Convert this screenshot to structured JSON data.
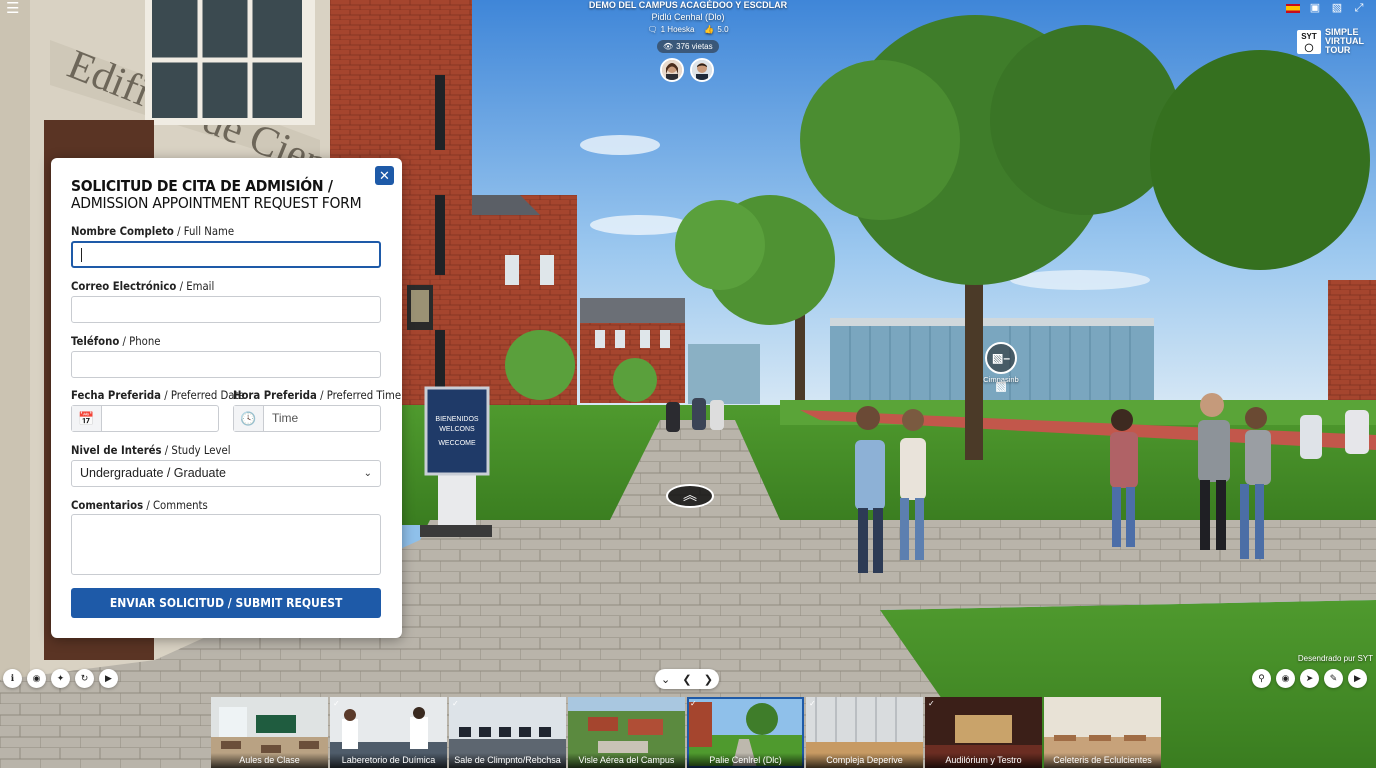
{
  "header": {
    "menu_icon": "hamburger-icon",
    "title": "DEMO DEL CAMPUS ACAGÉDOO Y ESCDLAR",
    "subtitle": "Pidlú Cenhal (Dlo)",
    "hosts": "1 Hoeska",
    "rating": "5.0",
    "views": "376 vietas"
  },
  "top_right_icons": [
    "flag-spain-icon",
    "info-box-icon",
    "vr-icon",
    "fullscreen-icon"
  ],
  "logo": {
    "box": "SYT",
    "line1": "SIMPLE",
    "line2": "VIRTUAL",
    "line3": "TOUR"
  },
  "scene": {
    "sign_line1": "BIENENIDOS",
    "sign_line2": "WELCONS",
    "sign_line3": "WECCOME",
    "building_text": "Edificio de Cien",
    "gym_label": "Cimnasinb"
  },
  "form": {
    "title_es": "SOLICITUD DE CITA DE ADMISIÓN /",
    "title_en": "ADMISSION APPOINTMENT REQUEST FORM",
    "name_label_es": "Nombre Completo",
    "name_label_en": " / Full Name",
    "name_value": "",
    "email_label_es": "Correo Electrónico",
    "email_label_en": " / Email",
    "email_value": "",
    "phone_label_es": "Teléfono",
    "phone_label_en": " / Phone",
    "phone_value": "",
    "date_label_es": "Fecha Preferida",
    "date_label_en": " / Preferred Date",
    "date_value": "",
    "time_label_es": "Hora Preferida",
    "time_label_en": " / Preferred Time",
    "time_placeholder": "Time",
    "level_label_es": "Nivel de Interés",
    "level_label_en": " / Study Level",
    "level_value": "Undergraduate / Graduate",
    "comments_label_es": "Comentarios",
    "comments_label_en": " / Comments",
    "comments_value": "",
    "submit_label": "ENVIAR SOLICITUD / SUBMIT REQUEST"
  },
  "powered_by": "Desendrado pur SYT",
  "thumbnails": [
    {
      "label": "Aules de Clase",
      "active": false
    },
    {
      "label": "Laberetorio de Duímica",
      "active": false
    },
    {
      "label": "Sale de Climpnto/Rebchsa",
      "active": false
    },
    {
      "label": "Visle Aérea del Campus",
      "active": false
    },
    {
      "label": "Palie Cenlrel (Dlc)",
      "active": true
    },
    {
      "label": "Compleja Deperive",
      "active": false
    },
    {
      "label": "Audilórium y Testro",
      "active": false
    },
    {
      "label": "Celeteris de Eclulcientes",
      "active": false
    }
  ],
  "colors": {
    "accent": "#1e5aa8",
    "panel": "#ffffff"
  }
}
